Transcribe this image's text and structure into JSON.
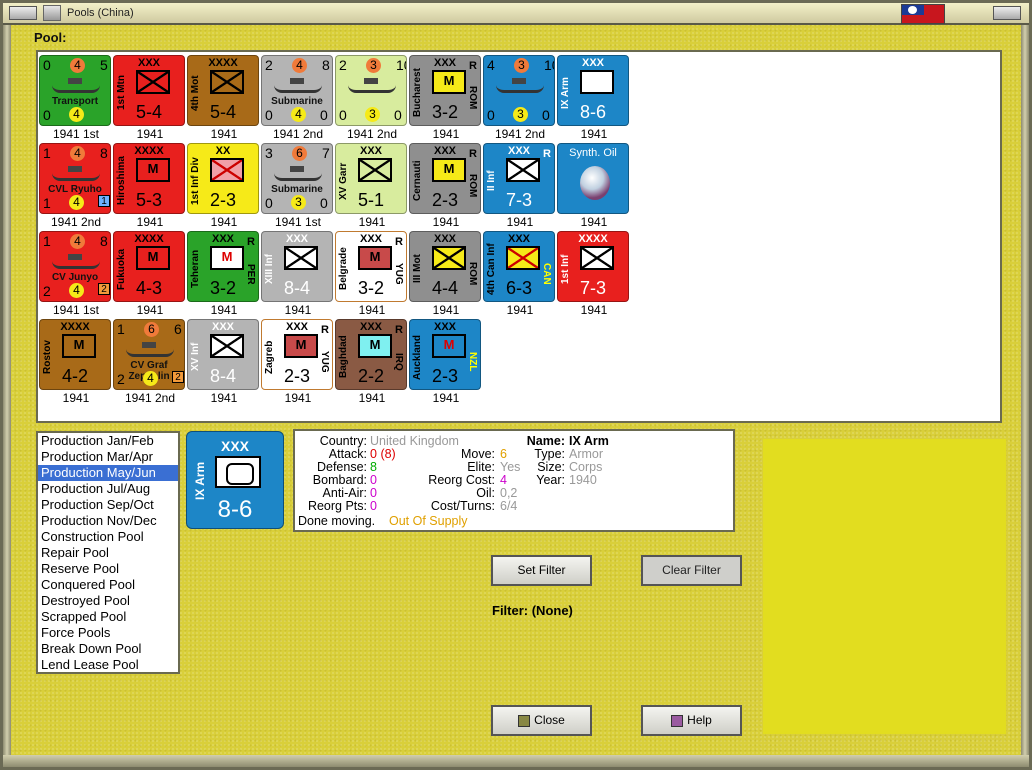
{
  "window": {
    "title": "Pools (China)"
  },
  "pool": {
    "label": "Pool:"
  },
  "counters": [
    {
      "label": "1941 1st",
      "kind": "naval",
      "bg": "#2aa329",
      "n": [
        "0",
        "4",
        "5"
      ],
      "mid": "Transport",
      "b": [
        "0",
        "4",
        ""
      ]
    },
    {
      "label": "1941",
      "kind": "land",
      "bg": "#e8201e",
      "top": "XXX",
      "name": "1st Mtn",
      "str": "5-4",
      "sym": "x"
    },
    {
      "label": "1941",
      "kind": "land",
      "bg": "#a86a18",
      "top": "XXXX",
      "name": "4th Mot",
      "str": "5-4",
      "sym": "x"
    },
    {
      "label": "1941 2nd",
      "kind": "naval",
      "bg": "#b4b4b4",
      "n": [
        "2",
        "4",
        "8"
      ],
      "mid": "Submarine",
      "b": [
        "0",
        "4",
        "0"
      ]
    },
    {
      "label": "1941 2nd",
      "kind": "naval",
      "bg": "#d8ec9e",
      "n": [
        "2",
        "3",
        "10"
      ],
      "mid": "",
      "b": [
        "0",
        "3",
        "0"
      ]
    },
    {
      "label": "1941",
      "kind": "land",
      "bg": "#8f8f8f",
      "top": "XXX",
      "name": "Bucharest",
      "country": "ROM",
      "str": "3-2",
      "m": "M",
      "side": "R",
      "boxbg": "#f6ea18"
    },
    {
      "label": "1941 2nd",
      "kind": "naval",
      "bg": "#1d86c7",
      "n": [
        "4",
        "3",
        "10"
      ],
      "mid": "",
      "b": [
        "0",
        "3",
        "0"
      ]
    },
    {
      "label": "1941",
      "kind": "land",
      "bg": "#1d86c7",
      "top": "XXX",
      "name": "IX Arm",
      "str": "8-6",
      "sym": "arm",
      "white": true
    },
    {
      "label": "1941 2nd",
      "kind": "naval",
      "bg": "#e8201e",
      "n": [
        "1",
        "4",
        "8"
      ],
      "mid": "CVL Ryuho",
      "b": [
        "1",
        "4",
        "1"
      ]
    },
    {
      "label": "1941",
      "kind": "land",
      "bg": "#e8201e",
      "top": "XXXX",
      "name": "Hiroshima",
      "str": "5-3",
      "m": "M"
    },
    {
      "label": "1941",
      "kind": "land",
      "bg": "#f6ea18",
      "top": "XX",
      "name": "1st Inf Div",
      "str": "2-3",
      "sym": "xr",
      "boxbg": "#f0a0a8"
    },
    {
      "label": "1941 1st",
      "kind": "naval",
      "bg": "#b4b4b4",
      "n": [
        "3",
        "6",
        "7"
      ],
      "mid": "Submarine",
      "b": [
        "0",
        "3",
        "0"
      ]
    },
    {
      "label": "1941",
      "kind": "land",
      "bg": "#d8ec9e",
      "top": "XXX",
      "name": "XV Garr",
      "str": "5-1",
      "sym": "x"
    },
    {
      "label": "1941",
      "kind": "land",
      "bg": "#8f8f8f",
      "top": "XXX",
      "name": "Cernauti",
      "country": "ROM",
      "str": "2-3",
      "m": "M",
      "side": "R",
      "boxbg": "#f6ea18"
    },
    {
      "label": "1941",
      "kind": "land",
      "bg": "#1d86c7",
      "top": "XXX",
      "name": "II Inf",
      "str": "7-3",
      "sym": "x",
      "side": "R",
      "white": true
    },
    {
      "label": "1941",
      "kind": "special",
      "bg": "#1d86c7",
      "top": "Synth. Oil"
    },
    {
      "label": "1941 1st",
      "kind": "naval",
      "bg": "#e8201e",
      "n": [
        "1",
        "4",
        "8"
      ],
      "mid": "CV Junyo",
      "b": [
        "2",
        "4",
        "2"
      ]
    },
    {
      "label": "1941",
      "kind": "land",
      "bg": "#e8201e",
      "top": "XXXX",
      "name": "Fukuoka",
      "str": "4-3",
      "m": "M"
    },
    {
      "label": "1941",
      "kind": "land",
      "bg": "#2aa329",
      "top": "XXX",
      "name": "Teheran",
      "country": "PER",
      "str": "3-2",
      "m": "M",
      "side": "R",
      "boxbg": "#fff",
      "mred": true
    },
    {
      "label": "1941",
      "kind": "land",
      "bg": "#b4b4b4",
      "top": "XXX",
      "name": "XIII Inf",
      "str": "8-4",
      "sym": "x",
      "white": true
    },
    {
      "label": "1941",
      "kind": "land",
      "bg": "#ffffff",
      "top": "XXX",
      "name": "Belgrade",
      "country": "YUG",
      "str": "3-2",
      "m": "M",
      "side": "R",
      "boxbg": "#c84a4a",
      "border": "#c07a30"
    },
    {
      "label": "1941",
      "kind": "land",
      "bg": "#8f8f8f",
      "top": "XXX",
      "name": "III Mot",
      "country": "ROM",
      "str": "4-4",
      "sym": "x",
      "boxbg": "#f6ea18"
    },
    {
      "label": "1941",
      "kind": "land",
      "bg": "#1d86c7",
      "top": "XXX",
      "name": "4th Can Inf",
      "country": "CAN",
      "str": "6-3",
      "sym": "xr",
      "boxbg": "#f6ea18"
    },
    {
      "label": "1941",
      "kind": "land",
      "bg": "#e8201e",
      "top": "XXXX",
      "name": "1st Inf",
      "str": "7-3",
      "sym": "x",
      "white": true
    },
    {
      "label": "1941",
      "kind": "land",
      "bg": "#a86a18",
      "top": "XXXX",
      "name": "Rostov",
      "str": "4-2",
      "m": "M"
    },
    {
      "label": "1941 2nd",
      "kind": "naval",
      "bg": "#a86a18",
      "n": [
        "1",
        "6",
        "6"
      ],
      "mid": "CV Graf Zeppelin",
      "b": [
        "2",
        "4",
        "2"
      ]
    },
    {
      "label": "1941",
      "kind": "land",
      "bg": "#b4b4b4",
      "top": "XXX",
      "name": "XV Inf",
      "str": "8-4",
      "sym": "x",
      "white": true
    },
    {
      "label": "1941",
      "kind": "land",
      "bg": "#ffffff",
      "top": "XXX",
      "name": "Zagreb",
      "country": "YUG",
      "str": "2-3",
      "m": "M",
      "side": "R",
      "boxbg": "#c84a4a",
      "border": "#c07a30"
    },
    {
      "label": "1941",
      "kind": "land",
      "bg": "#8a5a44",
      "top": "XXX",
      "name": "Baghdad",
      "country": "IRQ",
      "str": "2-2",
      "m": "M",
      "side": "R",
      "boxbg": "#7ff0f0"
    },
    {
      "label": "1941",
      "kind": "land",
      "bg": "#1d86c7",
      "top": "XXX",
      "name": "Auckland",
      "country": "NZL",
      "str": "2-3",
      "m": "M",
      "boxbg": "#1d86c7",
      "mred": true
    }
  ],
  "production_list": {
    "selected_index": 2,
    "items": [
      "Production Jan/Feb",
      "Production Mar/Apr",
      "Production May/Jun",
      "Production Jul/Aug",
      "Production Sep/Oct",
      "Production Nov/Dec",
      "Construction Pool",
      "Repair Pool",
      "Reserve Pool",
      "Conquered Pool",
      "Destroyed Pool",
      "Scrapped Pool",
      "Force Pools",
      "Break Down Pool",
      "Lend Lease Pool"
    ]
  },
  "selected": {
    "top": "XXX",
    "name": "IX Arm",
    "str": "8-6"
  },
  "info": {
    "country_label": "Country:",
    "country": "United Kingdom",
    "attack_label": "Attack:",
    "attack": "0",
    "attack_extra": "(8)",
    "defense_label": "Defense:",
    "defense": "8",
    "bombard_label": "Bombard:",
    "bombard": "0",
    "antiair_label": "Anti-Air:",
    "antiair": "0",
    "reorg_label": "Reorg Pts:",
    "reorg": "0",
    "done_label": "Done moving.",
    "supply": "Out Of Supply",
    "move_label": "Move:",
    "move": "6",
    "elite_label": "Elite:",
    "elite": "Yes",
    "reorgcost_label": "Reorg Cost:",
    "reorgcost": "4",
    "oil_label": "Oil:",
    "oil": "0,2",
    "costturns_label": "Cost/Turns:",
    "costturns": "6/4",
    "name_label": "Name:",
    "name": "IX Arm",
    "type_label": "Type:",
    "type": "Armor",
    "size_label": "Size:",
    "size": "Corps",
    "year_label": "Year:",
    "year": "1940"
  },
  "buttons": {
    "set_filter": "Set Filter",
    "clear_filter": "Clear Filter",
    "close": "Close",
    "help": "Help"
  },
  "filter": {
    "text": "Filter: (None)"
  }
}
